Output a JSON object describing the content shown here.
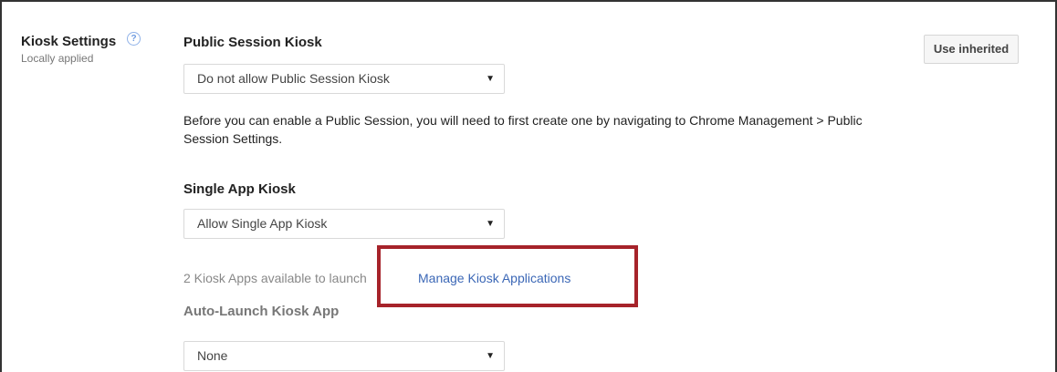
{
  "settings": {
    "title": "Kiosk Settings",
    "help_icon": "question-circle-icon",
    "subtitle": "Locally applied",
    "use_inherited_label": "Use inherited"
  },
  "public_session": {
    "heading": "Public Session Kiosk",
    "selected": "Do not allow Public Session Kiosk",
    "description": "Before you can enable a Public Session, you will need to first create one by navigating to Chrome Management > Public Session Settings."
  },
  "single_app": {
    "heading": "Single App Kiosk",
    "selected": "Allow Single App Kiosk",
    "available_text": "2 Kiosk Apps available to launch",
    "manage_link": "Manage Kiosk Applications",
    "auto_launch_label": "Auto-Launch Kiosk App",
    "auto_launch_selected": "None"
  },
  "colors": {
    "highlight": "#a6232a",
    "link": "#3b67b6"
  }
}
